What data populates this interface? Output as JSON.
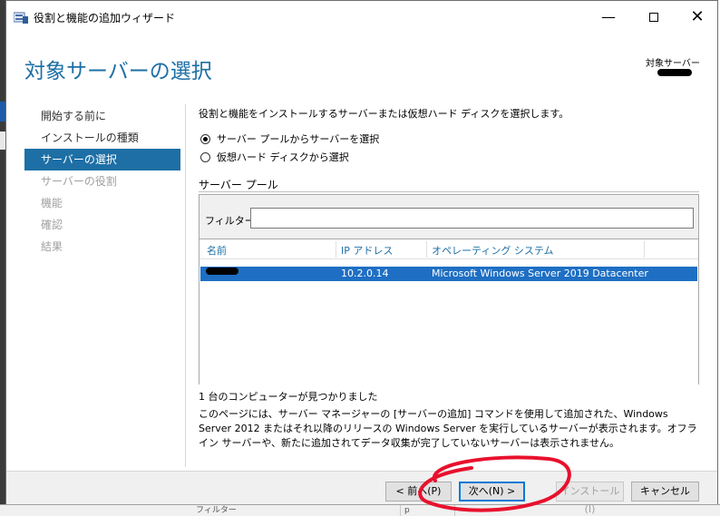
{
  "window": {
    "title": "役割と機能の追加ウィザード",
    "minimize_glyph": "—",
    "close_glyph": "✕"
  },
  "header": {
    "page_title": "対象サーバーの選択",
    "target_server_label": "対象サーバー"
  },
  "nav": {
    "items": [
      {
        "label": "開始する前に",
        "state": "normal"
      },
      {
        "label": "インストールの種類",
        "state": "normal"
      },
      {
        "label": "サーバーの選択",
        "state": "active"
      },
      {
        "label": "サーバーの役割",
        "state": "disabled"
      },
      {
        "label": "機能",
        "state": "disabled"
      },
      {
        "label": "確認",
        "state": "disabled"
      },
      {
        "label": "結果",
        "state": "disabled"
      }
    ]
  },
  "content": {
    "intro": "役割と機能をインストールするサーバーまたは仮想ハード ディスクを選択します。",
    "radio_pool": "サーバー プールからサーバーを選択",
    "radio_vhd": "仮想ハード ディスクから選択",
    "pool_title": "サーバー プール",
    "filter_label": "フィルター:",
    "filter_value": "",
    "columns": [
      "名前",
      "IP アドレス",
      "オペレーティング システム"
    ],
    "rows": [
      {
        "ip": "10.2.0.14",
        "os": "Microsoft Windows Server 2019 Datacenter"
      }
    ],
    "found": "1 台のコンピューターが見つかりました",
    "description": "このページには、サーバー マネージャーの [サーバーの追加] コマンドを使用して追加された、Windows Server 2012 またはそれ以降のリリースの Windows Server を実行しているサーバーが表示されます。オフライン サーバーや、新たに追加されてデータ収集が完了していないサーバーは表示されません。"
  },
  "footer": {
    "prev": "< 前へ(P)",
    "next": "次へ(N) >",
    "install": "インストール(I)",
    "cancel": "キャンセル"
  },
  "background": {
    "bottom_cells": [
      "フィルター",
      "p"
    ]
  },
  "colors": {
    "accent": "#1d6fa5",
    "selection": "#1e6fc4",
    "annotation": "#e8112d"
  }
}
